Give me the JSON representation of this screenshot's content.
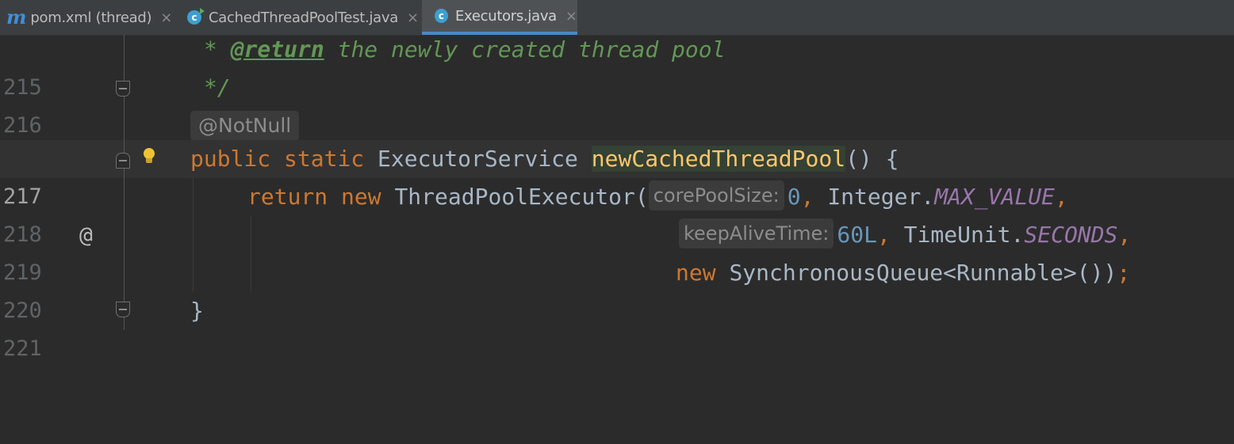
{
  "tabs": [
    {
      "label": "pom.xml (thread)",
      "icon": "maven-icon",
      "active": false
    },
    {
      "label": "CachedThreadPoolTest.java",
      "icon": "java-class-run-icon",
      "active": false
    },
    {
      "label": "Executors.java",
      "icon": "java-class-icon",
      "active": true
    }
  ],
  "tab_close_glyph": "×",
  "editor": {
    "lines": [
      {
        "number": "215",
        "comment_star": "* ",
        "tag": "@return",
        "comment_text": " the newly created thread pool"
      },
      {
        "number": "216",
        "comment_end": "*/"
      },
      {
        "annotation_hint": "@NotNull"
      },
      {
        "number": "217",
        "gutter_marker": "@",
        "kw_public": "public",
        "kw_static": "static",
        "return_type": "ExecutorService",
        "method_name": "newCachedThreadPool",
        "signature_tail": "() {"
      },
      {
        "number": "218",
        "kw_return": "return",
        "kw_new": "new",
        "class_name": "ThreadPoolExecutor(",
        "hint": "corePoolSize:",
        "value": "0",
        "comma": ", ",
        "type": "Integer.",
        "constant": "MAX_VALUE",
        "trail": ","
      },
      {
        "number": "219",
        "hint": "keepAliveTime:",
        "value": "60L",
        "comma": ", ",
        "type": "TimeUnit.",
        "constant": "SECONDS",
        "trail": ","
      },
      {
        "number": "220",
        "kw_new": "new",
        "expr": "SynchronousQueue<Runnable>())",
        "trail": ";"
      },
      {
        "number": "221",
        "close_brace": "}"
      }
    ]
  },
  "colors": {
    "background": "#2b2b2b",
    "keyword": "#cc7832",
    "comment": "#629755",
    "method": "#ffc66d",
    "number": "#6897bb",
    "constant": "#9876aa",
    "text": "#a9b7c6",
    "tab_underline": "#4a88c7"
  }
}
